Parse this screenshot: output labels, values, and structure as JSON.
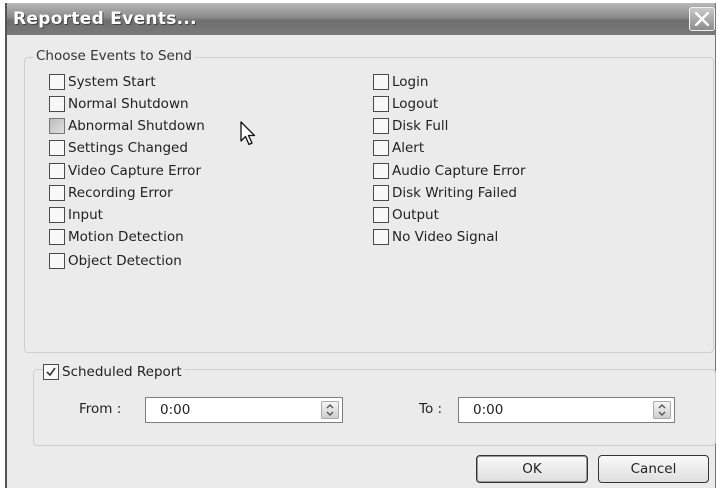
{
  "window": {
    "title": "Reported Events..."
  },
  "events_group": {
    "legend": "Choose Events to Send",
    "left_column": [
      {
        "label": "System Start",
        "checked": false
      },
      {
        "label": "Normal Shutdown",
        "checked": false
      },
      {
        "label": "Abnormal Shutdown",
        "checked": false,
        "hover": true
      },
      {
        "label": "Settings Changed",
        "checked": false
      },
      {
        "label": "Video Capture Error",
        "checked": false
      },
      {
        "label": "Recording Error",
        "checked": false
      },
      {
        "label": "Input",
        "checked": false
      },
      {
        "label": "Motion Detection",
        "checked": false
      },
      {
        "label": "Object Detection",
        "checked": false
      }
    ],
    "right_column": [
      {
        "label": "Login",
        "checked": false
      },
      {
        "label": "Logout",
        "checked": false
      },
      {
        "label": "Disk Full",
        "checked": false
      },
      {
        "label": "Alert",
        "checked": false
      },
      {
        "label": "Audio Capture Error",
        "checked": false
      },
      {
        "label": "Disk Writing Failed",
        "checked": false
      },
      {
        "label": "Output",
        "checked": false
      },
      {
        "label": "No Video Signal",
        "checked": false
      }
    ]
  },
  "schedule": {
    "label": "Scheduled Report",
    "checked": true,
    "from_label": "From :",
    "from_value": "0:00",
    "to_label": "To :",
    "to_value": "0:00"
  },
  "buttons": {
    "ok": "OK",
    "cancel": "Cancel"
  },
  "icons": {
    "close": "close-icon",
    "spin": "spin-arrows-icon",
    "cursor": "mouse-cursor-icon",
    "check": "checkmark-icon"
  }
}
